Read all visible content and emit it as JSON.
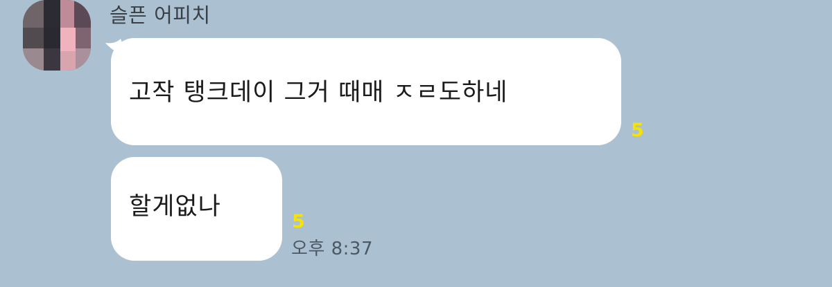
{
  "chat": {
    "sender_name": "슬픈 어피치",
    "messages": [
      {
        "text": "고작 탱크데이 그거 때매 ㅈㄹ도하네",
        "unread_count": "5"
      },
      {
        "text": "할게없나",
        "unread_count": "5",
        "time": "오후 8:37"
      }
    ]
  },
  "icons": {
    "avatar": "profile-avatar-pixelated"
  },
  "colors": {
    "background": "#abc1d1",
    "bubble": "#ffffff",
    "unread": "#f5e20a",
    "timestamp": "#4c5863"
  }
}
